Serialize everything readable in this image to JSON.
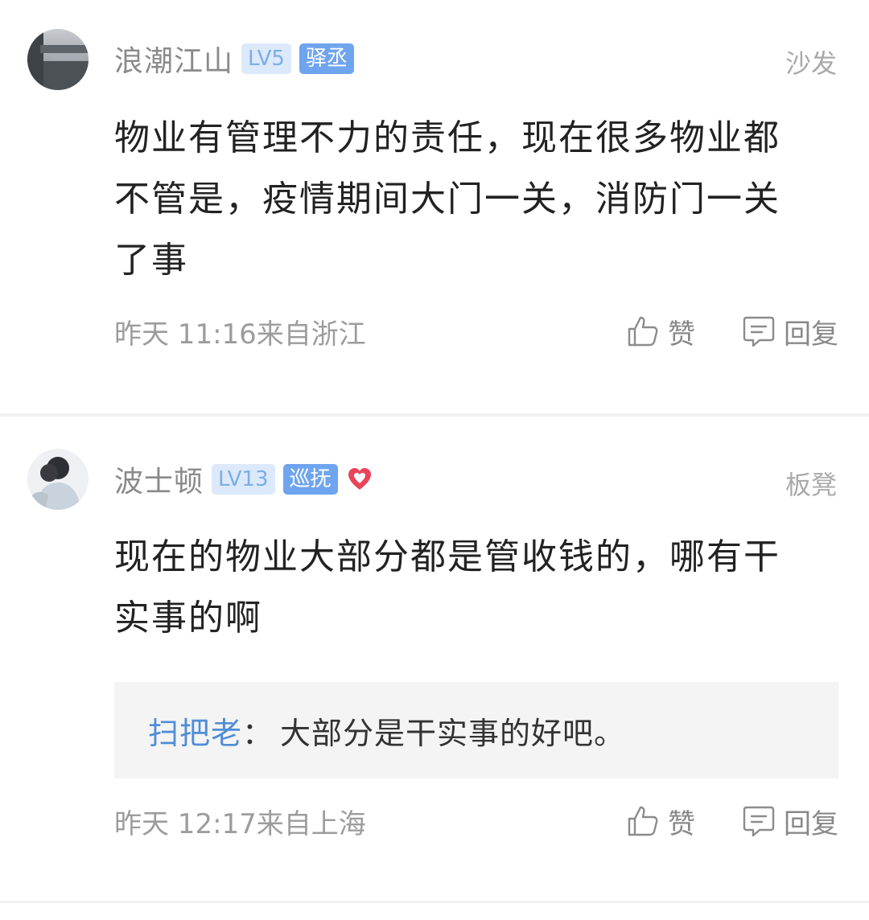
{
  "comments": [
    {
      "username": "浪潮江山",
      "level": "LV5",
      "title": "驿丞",
      "floor": "沙发",
      "text": "物业有管理不力的责任，现在很多物业都不管是，疫情期间大门一关，消防门一关了事",
      "time": "昨天 11:16来自浙江",
      "like_label": "赞",
      "reply_label": "回复"
    },
    {
      "username": "波士顿",
      "level": "LV13",
      "title": "巡抚",
      "floor": "板凳",
      "text": "现在的物业大部分都是管收钱的，哪有干实事的啊",
      "reply": {
        "author": "扫把老",
        "separator": "：",
        "text": "大部分是干实事的好吧。"
      },
      "time": "昨天 12:17来自上海",
      "like_label": "赞",
      "reply_label": "回复"
    }
  ],
  "icons": {
    "like": "thumbs-up-icon",
    "reply": "comment-bubble-icon",
    "badge": "heart-icon"
  },
  "colors": {
    "accent_blue": "#6fa4ee",
    "reply_author": "#4f8ed6",
    "heart": "#e8455a"
  }
}
